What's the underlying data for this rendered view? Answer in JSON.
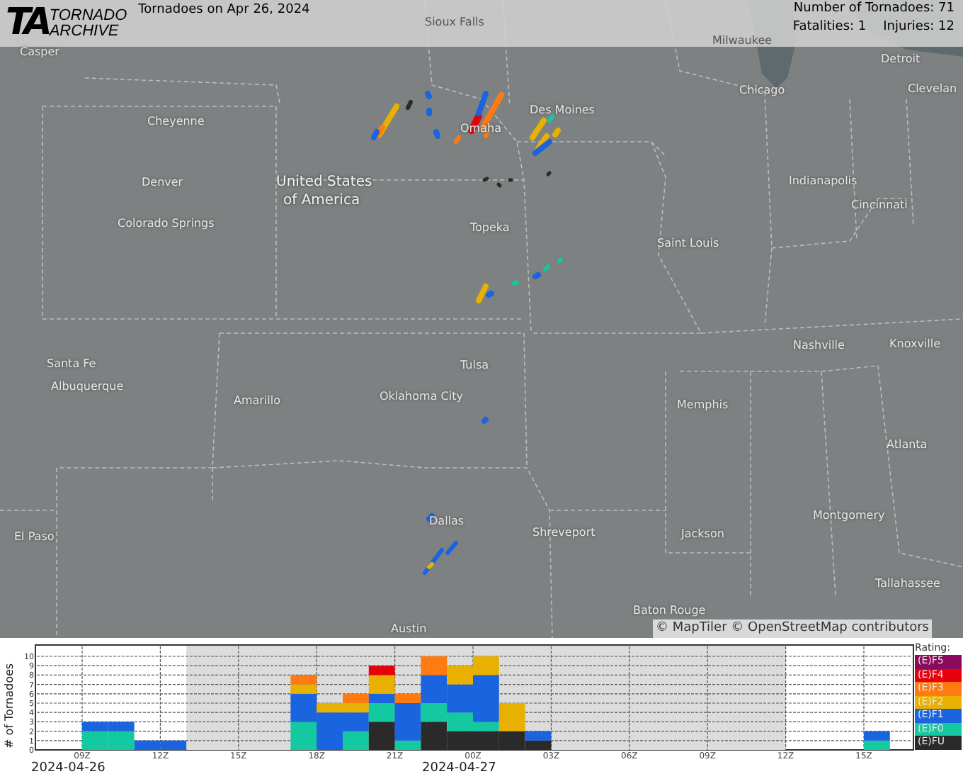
{
  "header": {
    "logo_mark": "TA",
    "logo_line_1": "TORNADO",
    "logo_line_2": "ARCHIVE",
    "title": "Tornadoes on Apr 26, 2024",
    "count": "Number of Tornadoes: 71",
    "fatalities": "Fatalities: 1",
    "injuries": "Injuries: 12"
  },
  "map": {
    "labels": [
      {
        "text": "Casper",
        "kind": "city"
      },
      {
        "text": "Sioux Falls",
        "kind": "city"
      },
      {
        "text": "Milwaukee",
        "kind": "city"
      },
      {
        "text": "Detroit",
        "kind": "city"
      },
      {
        "text": "Clevelan",
        "kind": "city"
      },
      {
        "text": "Chicago",
        "kind": "city"
      },
      {
        "text": "Des Moines",
        "kind": "city"
      },
      {
        "text": "Omaha",
        "kind": "city"
      },
      {
        "text": "Cheyenne",
        "kind": "city"
      },
      {
        "text": "Denver",
        "kind": "city"
      },
      {
        "text": "United States",
        "kind": "country"
      },
      {
        "text": "of America",
        "kind": "country"
      },
      {
        "text": "Indianapolis",
        "kind": "city"
      },
      {
        "text": "Cincinnati",
        "kind": "city"
      },
      {
        "text": "Colorado Springs",
        "kind": "city"
      },
      {
        "text": "Topeka",
        "kind": "city"
      },
      {
        "text": "Saint Louis",
        "kind": "city"
      },
      {
        "text": "Nashville",
        "kind": "city"
      },
      {
        "text": "Knoxville",
        "kind": "city"
      },
      {
        "text": "Santa Fe",
        "kind": "city"
      },
      {
        "text": "Albuquerque",
        "kind": "city"
      },
      {
        "text": "Amarillo",
        "kind": "city"
      },
      {
        "text": "Tulsa",
        "kind": "city"
      },
      {
        "text": "Oklahoma City",
        "kind": "city"
      },
      {
        "text": "Memphis",
        "kind": "city"
      },
      {
        "text": "Atlanta",
        "kind": "city"
      },
      {
        "text": "Dallas",
        "kind": "city"
      },
      {
        "text": "Montgomery",
        "kind": "city"
      },
      {
        "text": "El Paso",
        "kind": "city"
      },
      {
        "text": "Shreveport",
        "kind": "city"
      },
      {
        "text": "Jackson",
        "kind": "city"
      },
      {
        "text": "Tallahassee",
        "kind": "city"
      },
      {
        "text": "Baton Rouge",
        "kind": "city"
      },
      {
        "text": "Austin",
        "kind": "city"
      }
    ],
    "attribution": "© MapTiler © OpenStreetMap contributors"
  },
  "timeline": {
    "chart_data": {
      "type": "bar",
      "stacked": true,
      "ylabel": "# of Tornadoes",
      "yticks": [
        0,
        1,
        2,
        3,
        4,
        5,
        6,
        7,
        8,
        9,
        10
      ],
      "ylim": [
        0,
        10
      ],
      "grid": true,
      "categories": [
        "09Z",
        null,
        null,
        "12Z",
        null,
        null,
        "15Z",
        null,
        null,
        "18Z",
        null,
        null,
        "21Z",
        null,
        null,
        "00Z",
        null,
        null,
        "03Z",
        null,
        null,
        "06Z",
        null,
        null,
        "09Z",
        null,
        null,
        "12Z",
        null,
        null,
        "15Z",
        null
      ],
      "series": [
        {
          "name": "(E)FU",
          "color": "#2a2a2a",
          "values": [
            0,
            0,
            0,
            0,
            0,
            0,
            0,
            0,
            0,
            0,
            0,
            3,
            0,
            3,
            2,
            2,
            2,
            1,
            0,
            0,
            0,
            0,
            0,
            0,
            0,
            0,
            0,
            0,
            0,
            0,
            0,
            0
          ]
        },
        {
          "name": "(E)F0",
          "color": "#14c8a0",
          "values": [
            2,
            2,
            0,
            0,
            0,
            0,
            0,
            0,
            3,
            0,
            2,
            2,
            1,
            2,
            2,
            1,
            0,
            0,
            0,
            0,
            0,
            0,
            0,
            0,
            0,
            0,
            0,
            0,
            0,
            0,
            1,
            0
          ]
        },
        {
          "name": "(E)F1",
          "color": "#1a64e0",
          "values": [
            1,
            1,
            1,
            1,
            0,
            0,
            0,
            0,
            3,
            4,
            2,
            1,
            4,
            3,
            3,
            5,
            0,
            1,
            0,
            0,
            0,
            0,
            0,
            0,
            0,
            0,
            0,
            0,
            0,
            0,
            1,
            0
          ]
        },
        {
          "name": "(E)F2",
          "color": "#e8b000",
          "values": [
            0,
            0,
            0,
            0,
            0,
            0,
            0,
            0,
            1,
            1,
            1,
            2,
            0,
            0,
            2,
            2,
            3,
            0,
            0,
            0,
            0,
            0,
            0,
            0,
            0,
            0,
            0,
            0,
            0,
            0,
            0,
            0
          ]
        },
        {
          "name": "(E)F3",
          "color": "#ff7a10",
          "values": [
            0,
            0,
            0,
            0,
            0,
            0,
            0,
            0,
            1,
            0,
            1,
            0,
            1,
            2,
            0,
            0,
            0,
            0,
            0,
            0,
            0,
            0,
            0,
            0,
            0,
            0,
            0,
            0,
            0,
            0,
            0,
            0
          ]
        },
        {
          "name": "(E)F4",
          "color": "#e8000b",
          "values": [
            0,
            0,
            0,
            0,
            0,
            0,
            0,
            0,
            0,
            0,
            0,
            1,
            0,
            0,
            0,
            0,
            0,
            0,
            0,
            0,
            0,
            0,
            0,
            0,
            0,
            0,
            0,
            0,
            0,
            0,
            0,
            0
          ]
        },
        {
          "name": "(E)F5",
          "color": "#8c0a5c",
          "values": [
            0,
            0,
            0,
            0,
            0,
            0,
            0,
            0,
            0,
            0,
            0,
            0,
            0,
            0,
            0,
            0,
            0,
            0,
            0,
            0,
            0,
            0,
            0,
            0,
            0,
            0,
            0,
            0,
            0,
            0,
            0,
            0
          ]
        }
      ]
    },
    "dates": [
      "2024-04-26",
      "2024-04-27"
    ],
    "legend_title": "Rating:"
  }
}
